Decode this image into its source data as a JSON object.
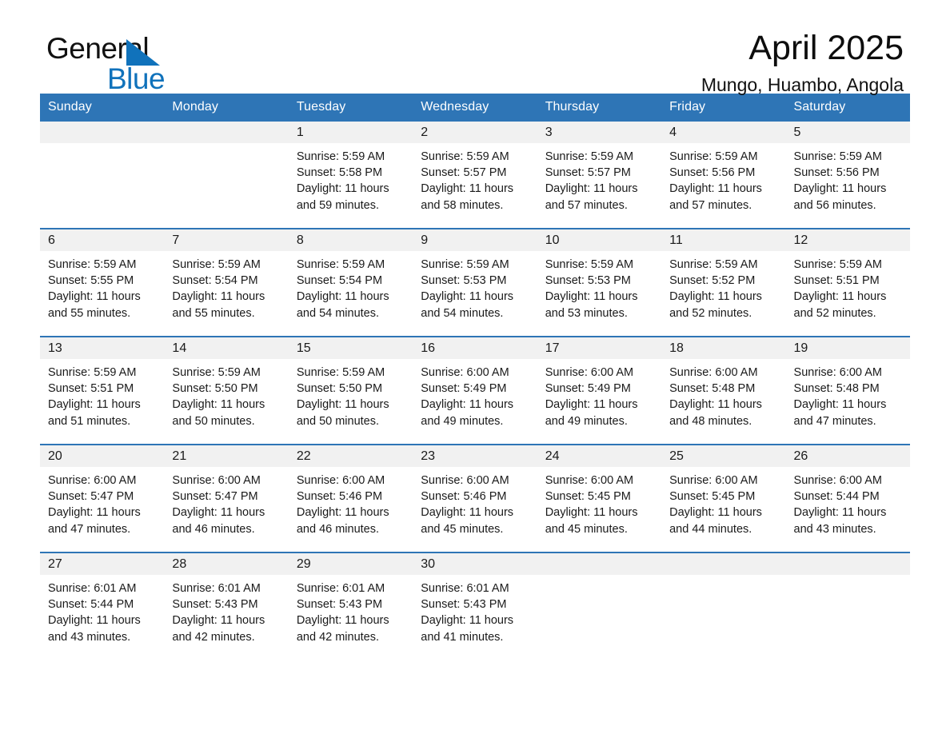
{
  "brand": {
    "name_part1": "General",
    "name_part2": "Blue",
    "logo_icon": "triangle-logo-icon",
    "accent_color": "#1072bb"
  },
  "header": {
    "title": "April 2025",
    "location": "Mungo, Huambo, Angola"
  },
  "theme": {
    "header_blue": "#2e75b6",
    "daynum_bg": "#f1f1f1",
    "text": "#1a1a1a"
  },
  "weekdays": [
    "Sunday",
    "Monday",
    "Tuesday",
    "Wednesday",
    "Thursday",
    "Friday",
    "Saturday"
  ],
  "weeks": [
    [
      {
        "day": "",
        "empty": true,
        "sunrise": "",
        "sunset": "",
        "daylight": ""
      },
      {
        "day": "",
        "empty": true,
        "sunrise": "",
        "sunset": "",
        "daylight": ""
      },
      {
        "day": "1",
        "sunrise": "Sunrise: 5:59 AM",
        "sunset": "Sunset: 5:58 PM",
        "daylight": "Daylight: 11 hours and 59 minutes."
      },
      {
        "day": "2",
        "sunrise": "Sunrise: 5:59 AM",
        "sunset": "Sunset: 5:57 PM",
        "daylight": "Daylight: 11 hours and 58 minutes."
      },
      {
        "day": "3",
        "sunrise": "Sunrise: 5:59 AM",
        "sunset": "Sunset: 5:57 PM",
        "daylight": "Daylight: 11 hours and 57 minutes."
      },
      {
        "day": "4",
        "sunrise": "Sunrise: 5:59 AM",
        "sunset": "Sunset: 5:56 PM",
        "daylight": "Daylight: 11 hours and 57 minutes."
      },
      {
        "day": "5",
        "sunrise": "Sunrise: 5:59 AM",
        "sunset": "Sunset: 5:56 PM",
        "daylight": "Daylight: 11 hours and 56 minutes."
      }
    ],
    [
      {
        "day": "6",
        "sunrise": "Sunrise: 5:59 AM",
        "sunset": "Sunset: 5:55 PM",
        "daylight": "Daylight: 11 hours and 55 minutes."
      },
      {
        "day": "7",
        "sunrise": "Sunrise: 5:59 AM",
        "sunset": "Sunset: 5:54 PM",
        "daylight": "Daylight: 11 hours and 55 minutes."
      },
      {
        "day": "8",
        "sunrise": "Sunrise: 5:59 AM",
        "sunset": "Sunset: 5:54 PM",
        "daylight": "Daylight: 11 hours and 54 minutes."
      },
      {
        "day": "9",
        "sunrise": "Sunrise: 5:59 AM",
        "sunset": "Sunset: 5:53 PM",
        "daylight": "Daylight: 11 hours and 54 minutes."
      },
      {
        "day": "10",
        "sunrise": "Sunrise: 5:59 AM",
        "sunset": "Sunset: 5:53 PM",
        "daylight": "Daylight: 11 hours and 53 minutes."
      },
      {
        "day": "11",
        "sunrise": "Sunrise: 5:59 AM",
        "sunset": "Sunset: 5:52 PM",
        "daylight": "Daylight: 11 hours and 52 minutes."
      },
      {
        "day": "12",
        "sunrise": "Sunrise: 5:59 AM",
        "sunset": "Sunset: 5:51 PM",
        "daylight": "Daylight: 11 hours and 52 minutes."
      }
    ],
    [
      {
        "day": "13",
        "sunrise": "Sunrise: 5:59 AM",
        "sunset": "Sunset: 5:51 PM",
        "daylight": "Daylight: 11 hours and 51 minutes."
      },
      {
        "day": "14",
        "sunrise": "Sunrise: 5:59 AM",
        "sunset": "Sunset: 5:50 PM",
        "daylight": "Daylight: 11 hours and 50 minutes."
      },
      {
        "day": "15",
        "sunrise": "Sunrise: 5:59 AM",
        "sunset": "Sunset: 5:50 PM",
        "daylight": "Daylight: 11 hours and 50 minutes."
      },
      {
        "day": "16",
        "sunrise": "Sunrise: 6:00 AM",
        "sunset": "Sunset: 5:49 PM",
        "daylight": "Daylight: 11 hours and 49 minutes."
      },
      {
        "day": "17",
        "sunrise": "Sunrise: 6:00 AM",
        "sunset": "Sunset: 5:49 PM",
        "daylight": "Daylight: 11 hours and 49 minutes."
      },
      {
        "day": "18",
        "sunrise": "Sunrise: 6:00 AM",
        "sunset": "Sunset: 5:48 PM",
        "daylight": "Daylight: 11 hours and 48 minutes."
      },
      {
        "day": "19",
        "sunrise": "Sunrise: 6:00 AM",
        "sunset": "Sunset: 5:48 PM",
        "daylight": "Daylight: 11 hours and 47 minutes."
      }
    ],
    [
      {
        "day": "20",
        "sunrise": "Sunrise: 6:00 AM",
        "sunset": "Sunset: 5:47 PM",
        "daylight": "Daylight: 11 hours and 47 minutes."
      },
      {
        "day": "21",
        "sunrise": "Sunrise: 6:00 AM",
        "sunset": "Sunset: 5:47 PM",
        "daylight": "Daylight: 11 hours and 46 minutes."
      },
      {
        "day": "22",
        "sunrise": "Sunrise: 6:00 AM",
        "sunset": "Sunset: 5:46 PM",
        "daylight": "Daylight: 11 hours and 46 minutes."
      },
      {
        "day": "23",
        "sunrise": "Sunrise: 6:00 AM",
        "sunset": "Sunset: 5:46 PM",
        "daylight": "Daylight: 11 hours and 45 minutes."
      },
      {
        "day": "24",
        "sunrise": "Sunrise: 6:00 AM",
        "sunset": "Sunset: 5:45 PM",
        "daylight": "Daylight: 11 hours and 45 minutes."
      },
      {
        "day": "25",
        "sunrise": "Sunrise: 6:00 AM",
        "sunset": "Sunset: 5:45 PM",
        "daylight": "Daylight: 11 hours and 44 minutes."
      },
      {
        "day": "26",
        "sunrise": "Sunrise: 6:00 AM",
        "sunset": "Sunset: 5:44 PM",
        "daylight": "Daylight: 11 hours and 43 minutes."
      }
    ],
    [
      {
        "day": "27",
        "sunrise": "Sunrise: 6:01 AM",
        "sunset": "Sunset: 5:44 PM",
        "daylight": "Daylight: 11 hours and 43 minutes."
      },
      {
        "day": "28",
        "sunrise": "Sunrise: 6:01 AM",
        "sunset": "Sunset: 5:43 PM",
        "daylight": "Daylight: 11 hours and 42 minutes."
      },
      {
        "day": "29",
        "sunrise": "Sunrise: 6:01 AM",
        "sunset": "Sunset: 5:43 PM",
        "daylight": "Daylight: 11 hours and 42 minutes."
      },
      {
        "day": "30",
        "sunrise": "Sunrise: 6:01 AM",
        "sunset": "Sunset: 5:43 PM",
        "daylight": "Daylight: 11 hours and 41 minutes."
      },
      {
        "day": "",
        "empty": true,
        "sunrise": "",
        "sunset": "",
        "daylight": ""
      },
      {
        "day": "",
        "empty": true,
        "sunrise": "",
        "sunset": "",
        "daylight": ""
      },
      {
        "day": "",
        "empty": true,
        "sunrise": "",
        "sunset": "",
        "daylight": ""
      }
    ]
  ]
}
